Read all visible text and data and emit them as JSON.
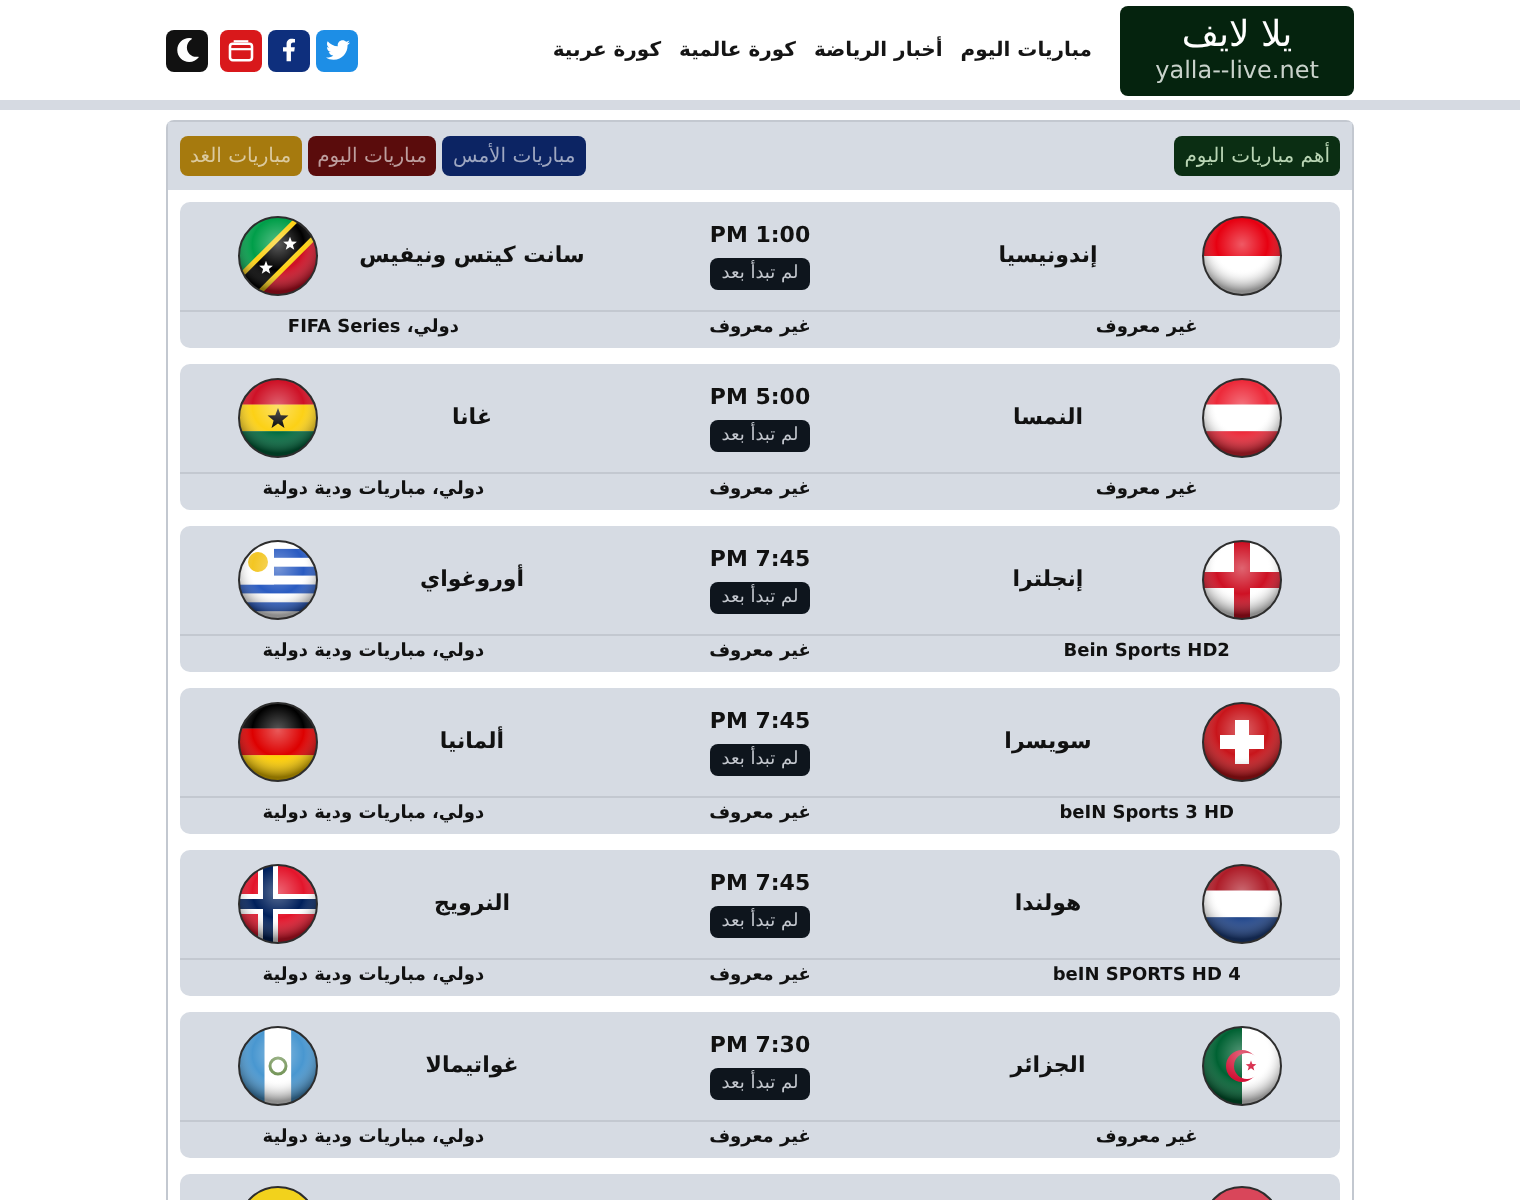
{
  "header": {
    "logo": {
      "title": "يلا لايف",
      "domain": "yalla--live.net"
    },
    "nav": [
      "مباريات اليوم",
      "أخبار الرياضة",
      "كورة عالمية",
      "كورة عربية"
    ]
  },
  "toolbar": {
    "featured_button": "أهم مباريات اليوم",
    "day_tabs": [
      {
        "label": "مباريات الأمس",
        "color": "#0c2463"
      },
      {
        "label": "مباريات اليوم",
        "color": "#5a0c0c"
      },
      {
        "label": "مباريات الغد",
        "color": "#a67a0e"
      }
    ]
  },
  "matches": [
    {
      "time": "PM 1:00",
      "status": "لم تبدأ بعد",
      "team_1": "إندونيسيا",
      "team_2": "سانت كيتس ونيفيس",
      "channel": "غير معروف",
      "commentator": "غير معروف",
      "competition": "دولي، FIFA Series"
    },
    {
      "time": "PM 5:00",
      "status": "لم تبدأ بعد",
      "team_1": "النمسا",
      "team_2": "غانا",
      "channel": "غير معروف",
      "commentator": "غير معروف",
      "competition": "دولي، مباريات ودية دولية"
    },
    {
      "time": "PM 7:45",
      "status": "لم تبدأ بعد",
      "team_1": "إنجلترا",
      "team_2": "أوروغواي",
      "channel": "Bein Sports HD2",
      "commentator": "غير معروف",
      "competition": "دولي، مباريات ودية دولية"
    },
    {
      "time": "PM 7:45",
      "status": "لم تبدأ بعد",
      "team_1": "سويسرا",
      "team_2": "ألمانيا",
      "channel": "beIN Sports 3 HD",
      "commentator": "غير معروف",
      "competition": "دولي، مباريات ودية دولية"
    },
    {
      "time": "PM 7:45",
      "status": "لم تبدأ بعد",
      "team_1": "هولندا",
      "team_2": "النرويج",
      "channel": "beIN SPORTS HD 4",
      "commentator": "غير معروف",
      "competition": "دولي، مباريات ودية دولية"
    },
    {
      "time": "PM 7:30",
      "status": "لم تبدأ بعد",
      "team_1": "الجزائر",
      "team_2": "غواتيمالا",
      "channel": "غير معروف",
      "commentator": "غير معروف",
      "competition": "دولي، مباريات ودية دولية"
    }
  ]
}
